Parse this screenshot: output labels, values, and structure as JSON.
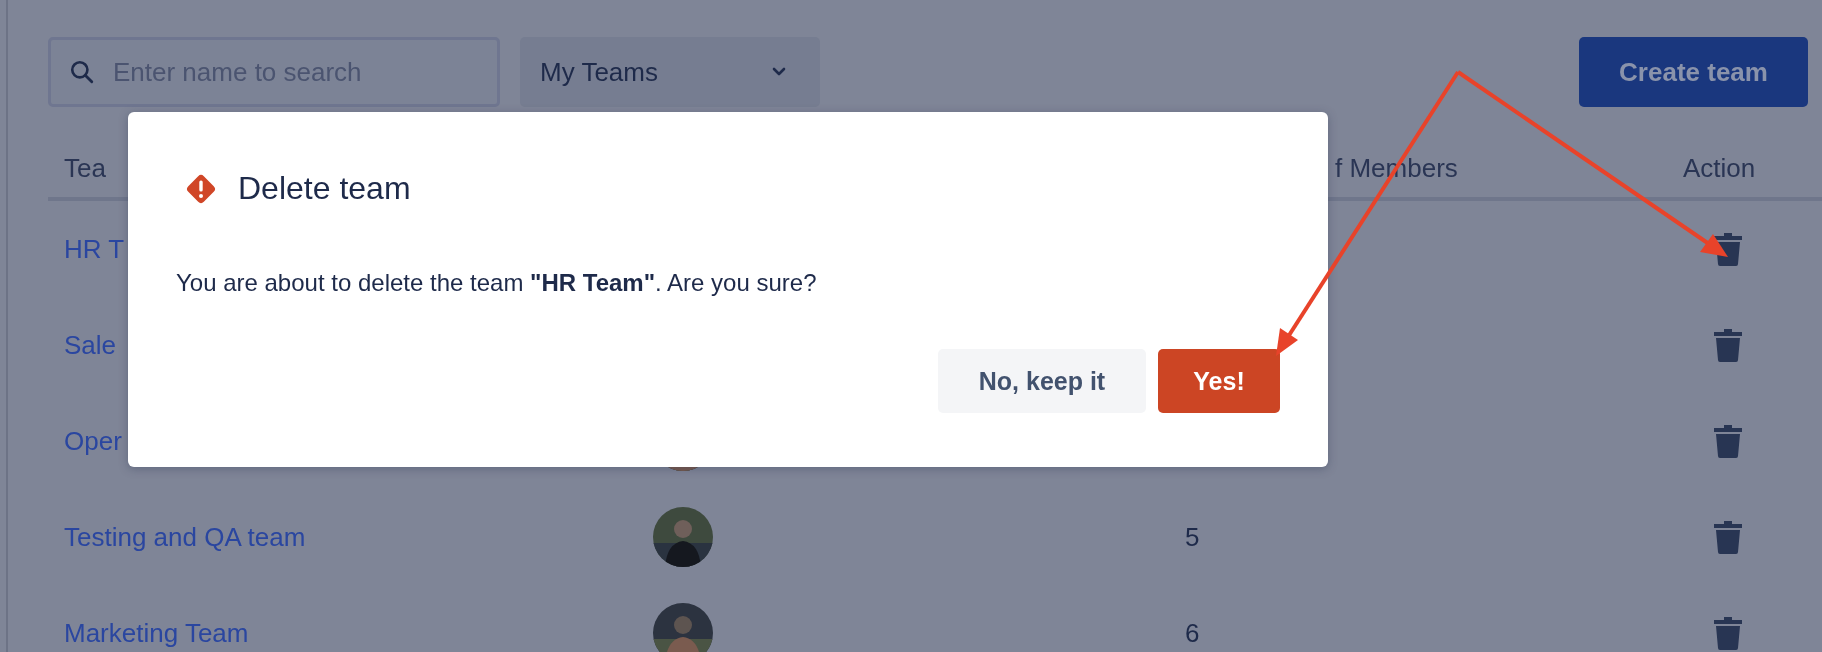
{
  "search": {
    "placeholder": "Enter name to search"
  },
  "filter": {
    "value": "My Teams"
  },
  "create_button": "Create team",
  "table": {
    "columns": [
      {
        "label": "Tea",
        "kind": "name"
      },
      {
        "label": "f Members",
        "kind": "members"
      },
      {
        "label": "Action",
        "kind": "action"
      }
    ],
    "rows": [
      {
        "name": "HR T"
      },
      {
        "name": "Sale"
      },
      {
        "name": "Oper"
      },
      {
        "name": "Testing and QA team",
        "members": "5"
      },
      {
        "name": "Marketing Team",
        "members": "6"
      }
    ]
  },
  "dialog": {
    "title": "Delete team",
    "message": "You are about to delete the team **\"HR Team\"**. Are you sure?",
    "buttons": [
      {
        "label": "No, keep it",
        "kind": "secondary"
      },
      {
        "label": "Yes!",
        "kind": "danger"
      }
    ]
  }
}
